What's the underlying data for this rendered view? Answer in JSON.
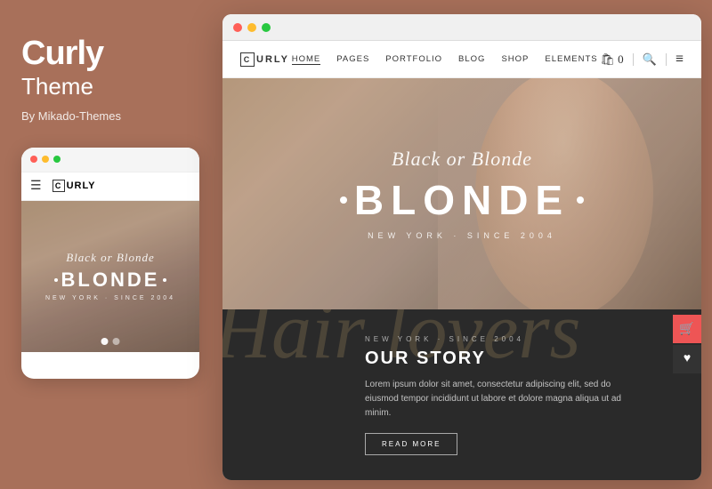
{
  "left": {
    "brand_name": "Curly",
    "brand_subtitle": "Theme",
    "brand_by": "By Mikado-Themes"
  },
  "mobile": {
    "top_bar_dots": [
      "red",
      "yellow",
      "green"
    ],
    "logo_letter": "C",
    "logo_text": "URLY",
    "hero_script": "Black or Blonde",
    "hero_main": "BLONDE",
    "hero_sub": "NEW YORK · SINCE 2004",
    "dots": [
      "active",
      "inactive"
    ]
  },
  "desktop": {
    "top_bar_dots": [
      "red",
      "yellow",
      "green"
    ],
    "logo_letter": "C",
    "logo_text": "URLY",
    "nav_items": [
      {
        "label": "HOME",
        "active": true
      },
      {
        "label": "PAGES",
        "active": false
      },
      {
        "label": "PORTFOLIO",
        "active": false
      },
      {
        "label": "BLOG",
        "active": false
      },
      {
        "label": "SHOP",
        "active": false
      },
      {
        "label": "ELEMENTS",
        "active": false
      }
    ],
    "hero_script": "Black or Blonde",
    "hero_main": "BLONDE",
    "hero_sub": "NEW YORK · SINCE 2004",
    "dark_bg_script": "Hair lovers",
    "dark_sub": "NEW YORK · SINCE 2004",
    "dark_title": "OUR STORY",
    "dark_text": "Lorem ipsum dolor sit amet, consectetur adipiscing elit, sed do eiusmod tempor incididunt ut labore et dolore magna aliqua ut ad minim.",
    "dark_button": "READ MORE",
    "cart_icon": "🛍",
    "search_icon": "🔍",
    "menu_icon": "≡"
  },
  "colors": {
    "background": "#a8705a",
    "desktop_hero_bg": "#c9a98a",
    "dark_section": "#2a2a2a",
    "white": "#ffffff"
  }
}
